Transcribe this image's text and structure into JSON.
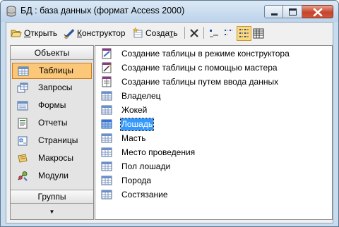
{
  "window": {
    "title": "БД : база данных (формат Access 2000)"
  },
  "toolbar": {
    "open_label": "Открыть",
    "design_label": "Конструктор",
    "create_label": "Создать",
    "open_accel": "О",
    "design_accel": "К",
    "create_accel": "т"
  },
  "nav": {
    "header": "Объекты",
    "items": [
      {
        "label": "Таблицы",
        "icon": "table-icon",
        "selected": true
      },
      {
        "label": "Запросы",
        "icon": "query-icon",
        "selected": false
      },
      {
        "label": "Формы",
        "icon": "form-icon",
        "selected": false
      },
      {
        "label": "Отчеты",
        "icon": "report-icon",
        "selected": false
      },
      {
        "label": "Страницы",
        "icon": "page-icon",
        "selected": false
      },
      {
        "label": "Макросы",
        "icon": "macro-icon",
        "selected": false
      },
      {
        "label": "Модули",
        "icon": "module-icon",
        "selected": false
      }
    ],
    "footer": "Группы"
  },
  "list": {
    "items": [
      {
        "label": "Создание таблицы в режиме конструктора",
        "icon": "shortcut-design-icon"
      },
      {
        "label": "Создание таблицы с помощью мастера",
        "icon": "shortcut-wizard-icon"
      },
      {
        "label": "Создание таблицы путем ввода данных",
        "icon": "shortcut-entry-icon"
      },
      {
        "label": "Владелец",
        "icon": "table-icon"
      },
      {
        "label": "Жокей",
        "icon": "table-icon"
      },
      {
        "label": "Лошадь",
        "icon": "table-icon",
        "selected": true
      },
      {
        "label": "Масть",
        "icon": "table-icon"
      },
      {
        "label": "Место проведения",
        "icon": "table-icon"
      },
      {
        "label": "Пол лошади",
        "icon": "table-icon"
      },
      {
        "label": "Порода",
        "icon": "table-icon"
      },
      {
        "label": "Состязание",
        "icon": "table-icon"
      }
    ]
  },
  "colors": {
    "selection": "#3399ff",
    "nav_selected": "#fbc87a",
    "close_button": "#c7432b"
  }
}
